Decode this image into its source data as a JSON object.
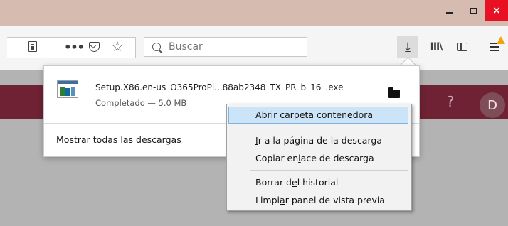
{
  "window": {
    "minimize_label": "–",
    "maximize_label": "□",
    "close_label": "×"
  },
  "toolbar": {
    "search_placeholder": "Buscar",
    "icons": [
      "reader-view-icon",
      "more-icon",
      "pocket-icon",
      "bookmark-star-icon",
      "search-icon",
      "download-icon",
      "library-icon",
      "sidebar-icon",
      "menu-icon",
      "update-warning-icon"
    ]
  },
  "page": {
    "help_icon": "?",
    "avatar_letter": "D",
    "accent_color": "#6e2233"
  },
  "downloads_panel": {
    "file_name": "Setup.X86.en-us_O365ProPl...88ab2348_TX_PR_b_16_.exe",
    "status": "Completado — 5.0 MB",
    "show_all_label": "Mostrar todas las descargas",
    "show_all_accesskey": "s"
  },
  "context_menu": {
    "items": [
      {
        "label": "Abrir carpeta contenedora",
        "accesskey": "A"
      },
      {
        "label": "Ir a la página de la descarga",
        "accesskey": "I"
      },
      {
        "label": "Copiar enlace de descarga",
        "accesskey": "l"
      },
      {
        "label": "Borrar del historial",
        "accesskey": "e"
      },
      {
        "label": "Limpiar panel de vista previa",
        "accesskey": "a"
      }
    ]
  }
}
